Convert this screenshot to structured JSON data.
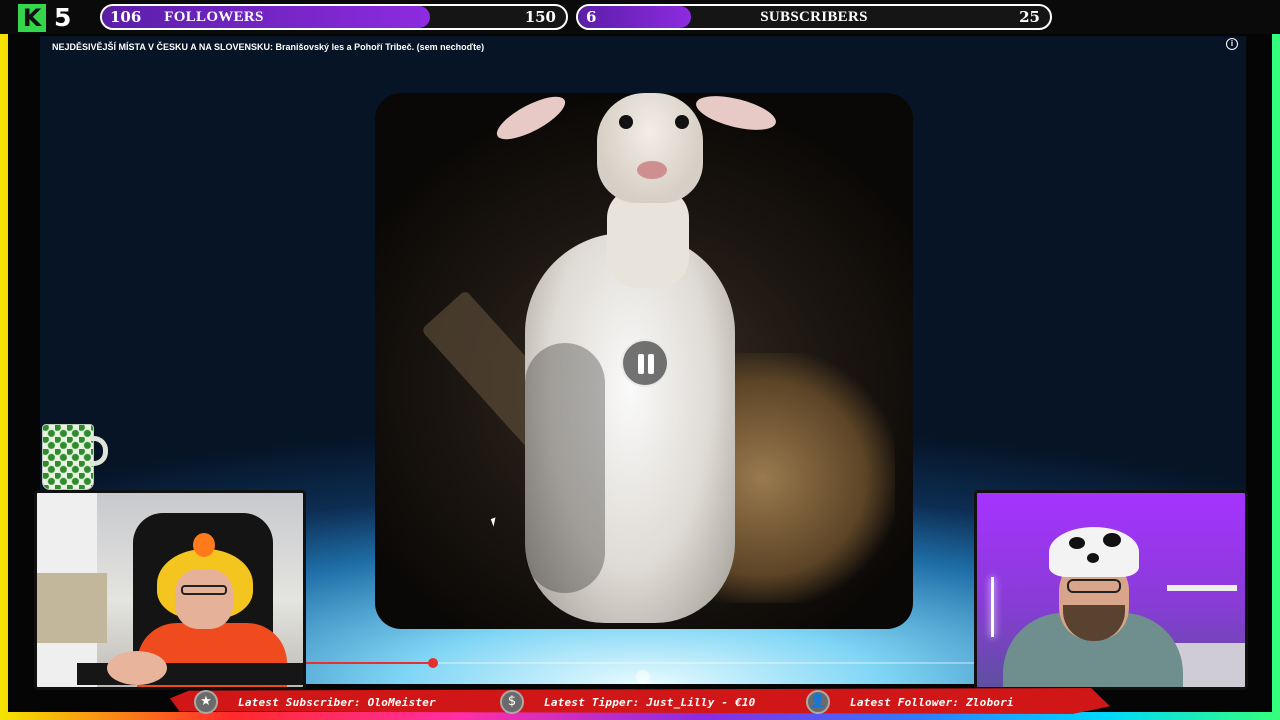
{
  "brand": {
    "logo_letter": "K",
    "logo_number": "5"
  },
  "goals": {
    "followers": {
      "current": "106",
      "label": "FOLLOWERS",
      "max": "150",
      "progress": 0.7067
    },
    "subscribers": {
      "current": "6",
      "label": "SUBSCRIBERS",
      "max": "25",
      "progress": 0.24
    }
  },
  "video": {
    "title": "NEJDĚSIVĚJŠÍ MÍSTA V ČESKU A NA SLOVENSKU: Branišovský les a Pohoří Tribeč. (sem nechoďte)",
    "info_icon": "i",
    "state": "paused",
    "progress": 0.19
  },
  "ticker": {
    "subscriber": {
      "icon": "star-icon",
      "glyph": "★",
      "text": "Latest Subscriber: OloMeister"
    },
    "tipper": {
      "icon": "dollar-icon",
      "glyph": "$",
      "text": "Latest Tipper: Just_Lilly - €10"
    },
    "follower": {
      "icon": "user-icon",
      "glyph": "👤",
      "text": "Latest Follower: Zlobori"
    }
  },
  "colors": {
    "accent_purple": "#8d2be0",
    "ticker_red": "#d01616",
    "kick_green": "#34d64b",
    "progress_red": "#e3322f"
  }
}
